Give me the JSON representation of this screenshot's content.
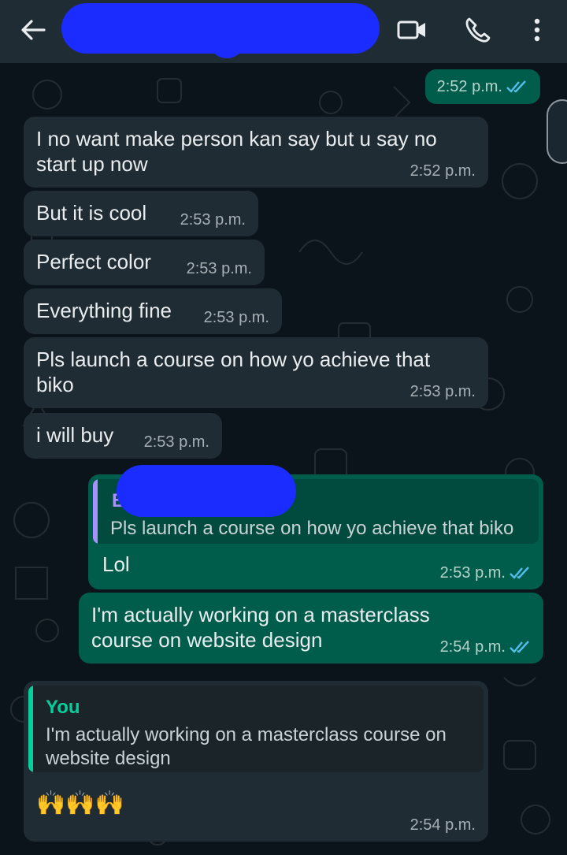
{
  "header": {
    "back_icon": "arrow-left-icon",
    "video_icon": "video-camera-icon",
    "call_icon": "phone-icon",
    "menu_icon": "more-vert-icon"
  },
  "messages": [
    {
      "id": "m0",
      "direction": "out",
      "text": "",
      "time": "2:52 p.m."
    },
    {
      "id": "m1",
      "direction": "in",
      "text": "I no want make person kan say but u say no start up now",
      "time": "2:52 p.m."
    },
    {
      "id": "m2",
      "direction": "in",
      "text": "But it is cool",
      "time": "2:53 p.m."
    },
    {
      "id": "m3",
      "direction": "in",
      "text": "Perfect color",
      "time": "2:53 p.m."
    },
    {
      "id": "m4",
      "direction": "in",
      "text": "Everything fine",
      "time": "2:53 p.m."
    },
    {
      "id": "m5",
      "direction": "in",
      "text": "Pls launch a course on how yo achieve that biko",
      "time": "2:53 p.m."
    },
    {
      "id": "m6",
      "direction": "in",
      "text": "i will buy",
      "time": "2:53 p.m."
    },
    {
      "id": "m7",
      "direction": "out",
      "quote_author": "B",
      "quote_text": "Pls launch a course on how yo achieve that biko",
      "text": "Lol",
      "time": "2:53 p.m."
    },
    {
      "id": "m8",
      "direction": "out",
      "text": "I'm actually working on a masterclass course on website design",
      "time": "2:54 p.m."
    },
    {
      "id": "m9",
      "direction": "in",
      "quote_author": "You",
      "quote_text": "I'm actually working on a masterclass course on website design",
      "text": "🙌🙌🙌",
      "time": "2:54 p.m."
    }
  ],
  "colors": {
    "background": "#0b141a",
    "header": "#1f2c34",
    "incoming": "#202c33",
    "outgoing": "#005c4b",
    "read_tick": "#53bdeb",
    "quote_you": "#06cf9c",
    "quote_other": "#a791ff",
    "redaction": "#1a2cff"
  }
}
